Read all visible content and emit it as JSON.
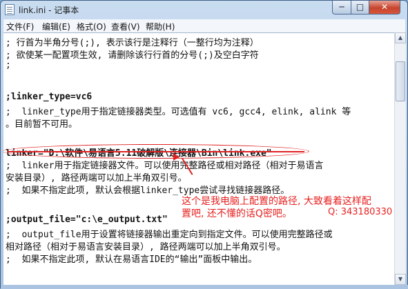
{
  "window": {
    "title": "link.ini - 记事本",
    "controls": {
      "minimize": "─",
      "maximize": "□",
      "close": "✕"
    }
  },
  "menu": [
    "文件(F)",
    "编辑(E)",
    "格式(O)",
    "查看(V)",
    "帮助(H)"
  ],
  "lines": [
    "; 行首为半角分号(;), 表示该行是注释行（一整行均为注释）",
    "; 欲使某一配置项生效, 请删除该行行首的分号(;)及空白字符",
    ";",
    ";linker_type=vc6",
    ";  linker_type用于指定链接器类型。可选值有 vc6, gcc4, elink, alink 等",
    "。目前暂不可用。",
    "linker=\"D:\\软件\\易语言5.11破解版\\连接器\\Bin\\link.exe\"",
    ";  linker用于指定链接器文件。可以使用完整路径或相对路径（相对于易语言",
    "安装目录）, 路径两端可以加上半角双引号。",
    ";  如果不指定此项, 默认会根据linker_type尝试寻找链接器路径。",
    ";output_file=\"c:\\e_output.txt\"",
    ";  output_file用于设置将链接器输出重定向到指定文件。可以使用完整路径或",
    "相对路径（相对于易语言安装目录）, 路径两端可以加上半角双引号。",
    ";  如果不指定此项, 默认在易语言IDE的“输出”面板中输出。"
  ],
  "annotation": {
    "line1": "这个是我电脑上配置的路径, 大致看着这样配",
    "line2": "置吧, 还不懂的话Q密吧。",
    "qq": "Q: 343180330",
    "color": "#e82020"
  },
  "scrollbar": {
    "up": "▲",
    "down": "▼",
    "thumb_fraction": 0.16
  }
}
